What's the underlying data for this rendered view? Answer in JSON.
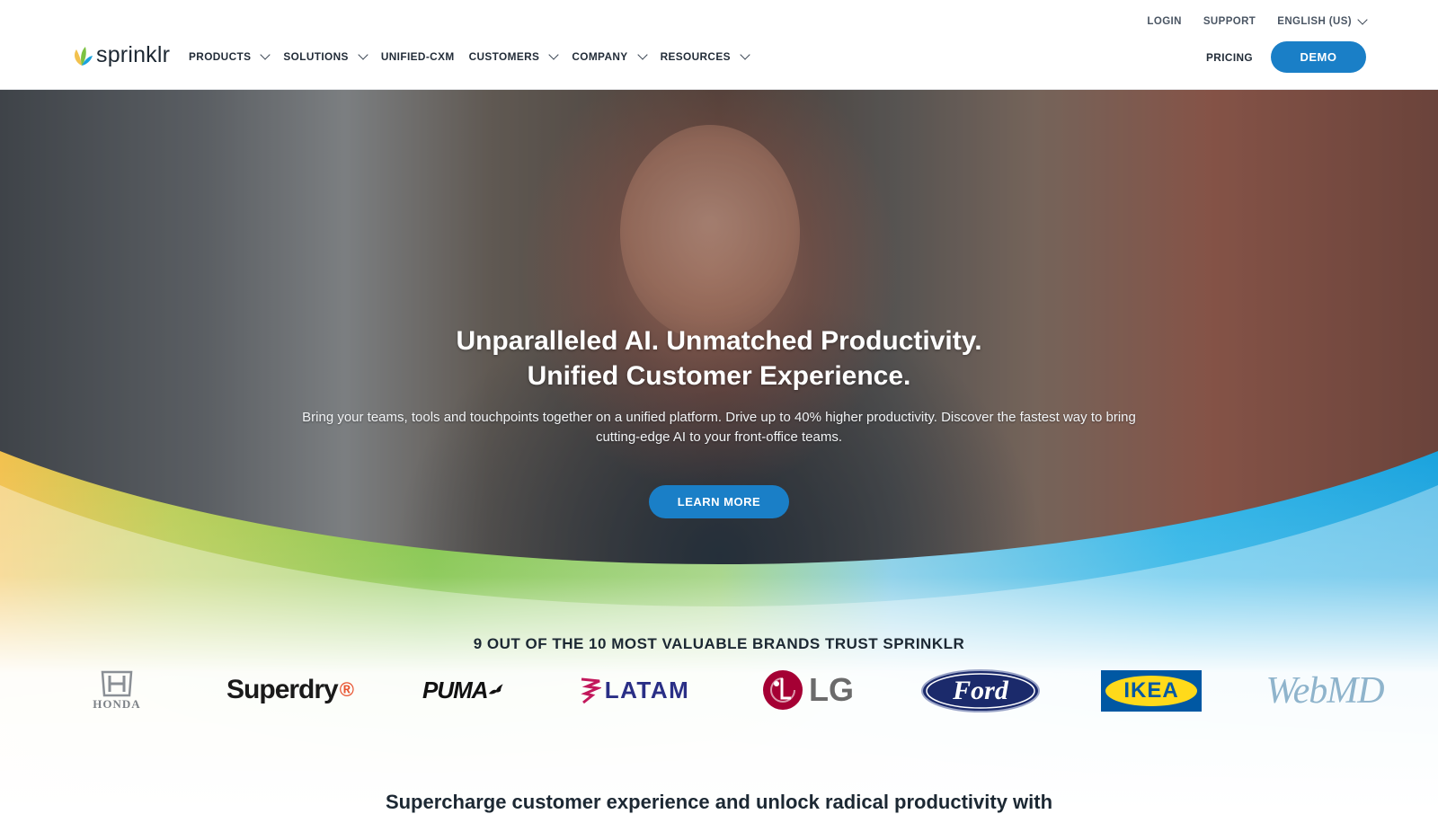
{
  "header": {
    "logo_text": "sprinklr",
    "utility": {
      "login": "LOGIN",
      "support": "SUPPORT",
      "language": "ENGLISH (US)"
    },
    "nav": [
      {
        "label": "PRODUCTS",
        "has_dropdown": true
      },
      {
        "label": "SOLUTIONS",
        "has_dropdown": true
      },
      {
        "label": "UNIFIED-CXM",
        "has_dropdown": false
      },
      {
        "label": "CUSTOMERS",
        "has_dropdown": true
      },
      {
        "label": "COMPANY",
        "has_dropdown": true
      },
      {
        "label": "RESOURCES",
        "has_dropdown": true
      }
    ],
    "pricing": "PRICING",
    "demo": "DEMO"
  },
  "hero": {
    "title_line1": "Unparalleled AI. Unmatched Productivity.",
    "title_line2": "Unified Customer Experience.",
    "subtitle": "Bring your teams, tools and touchpoints together on a unified platform. Drive up to 40% higher productivity. Discover the fastest way to bring cutting-edge AI to your front-office teams.",
    "cta": "LEARN MORE"
  },
  "brands": {
    "title": "9 OUT OF THE 10 MOST VALUABLE BRANDS TRUST SPRINKLR",
    "logos": [
      {
        "name": "Honda",
        "text": "HONDA",
        "icon": "honda-logo"
      },
      {
        "name": "Superdry",
        "text": "Superdry",
        "icon": "superdry-logo"
      },
      {
        "name": "Puma",
        "text": "PUMA",
        "icon": "puma-logo"
      },
      {
        "name": "LATAM",
        "text": "LATAM",
        "icon": "latam-logo"
      },
      {
        "name": "LG",
        "text": "LG",
        "icon": "lg-logo"
      },
      {
        "name": "Ford",
        "text": "Ford",
        "icon": "ford-logo"
      },
      {
        "name": "IKEA",
        "text": "IKEA",
        "icon": "ikea-logo"
      },
      {
        "name": "WebMD",
        "text": "WebMD",
        "icon": "webmd-logo"
      }
    ]
  },
  "next_section": {
    "heading": "Supercharge customer experience and unlock radical productivity with"
  },
  "colors": {
    "primary_button": "#1a7fc7",
    "wave_yellow": "#f2c14e",
    "wave_green": "#7cc242",
    "wave_blue": "#1aa3de",
    "text_dark": "#1c2833"
  }
}
